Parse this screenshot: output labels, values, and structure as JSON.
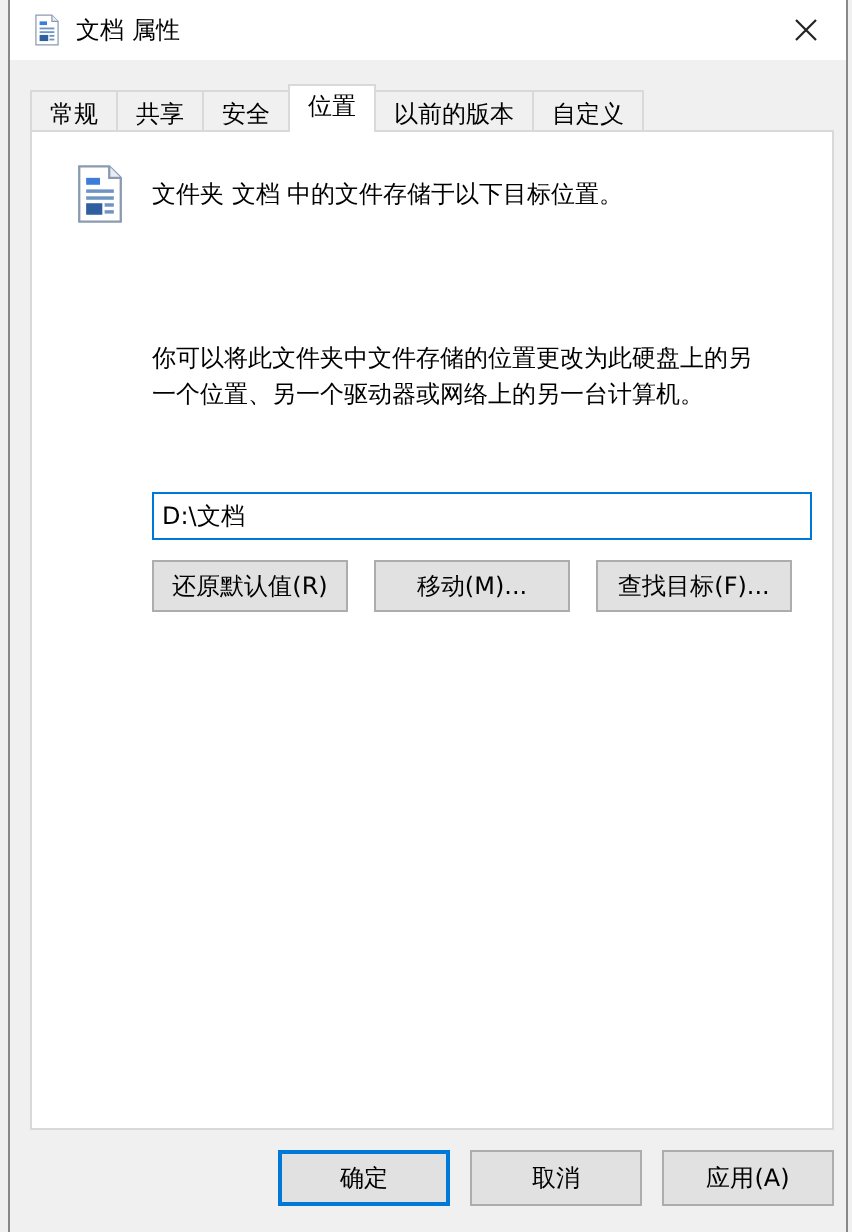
{
  "window": {
    "title": "文档 属性"
  },
  "tabs": [
    {
      "label": "常规",
      "selected": false
    },
    {
      "label": "共享",
      "selected": false
    },
    {
      "label": "安全",
      "selected": false
    },
    {
      "label": "位置",
      "selected": true
    },
    {
      "label": "以前的版本",
      "selected": false
    },
    {
      "label": "自定义",
      "selected": false
    }
  ],
  "intro": "文件夹 文档 中的文件存储于以下目标位置。",
  "description": "你可以将此文件夹中文件存储的位置更改为此硬盘上的另一个位置、另一个驱动器或网络上的另一台计算机。",
  "path_field": {
    "value": "D:\\文档"
  },
  "actions": [
    "还原默认值(R)",
    "移动(M)...",
    "查找目标(F)..."
  ],
  "buttons": [
    {
      "label": "确定",
      "default": true
    },
    {
      "label": "取消",
      "default": false
    },
    {
      "label": "应用(A)",
      "default": false
    }
  ]
}
